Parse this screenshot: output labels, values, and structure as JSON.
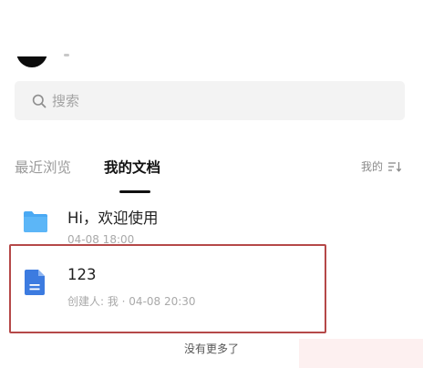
{
  "search": {
    "placeholder": "搜索"
  },
  "tabs": {
    "recent": "最近浏览",
    "mine": "我的文档"
  },
  "sort": {
    "label": "我的"
  },
  "files": [
    {
      "title": "Hi，欢迎使用",
      "meta": "04-08 18:00",
      "icon": "folder-icon"
    },
    {
      "title": "123",
      "meta": "创建人: 我 · 04-08 20:30",
      "icon": "document-icon"
    }
  ],
  "footer": {
    "text": "没有更多了"
  },
  "colors": {
    "folder": "#4aa9f3",
    "document": "#3c7be0",
    "highlight": "#b54848"
  }
}
